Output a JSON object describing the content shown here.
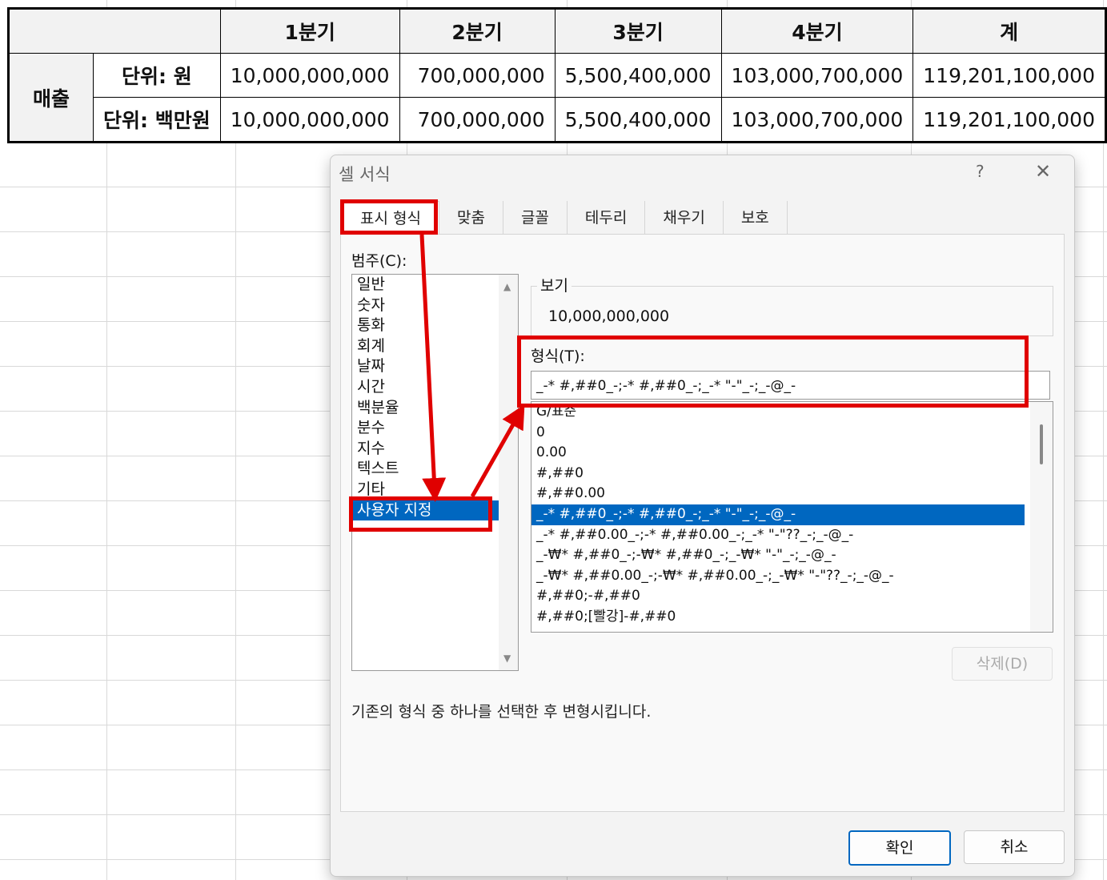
{
  "table": {
    "headers": [
      "",
      "1분기",
      "2분기",
      "3분기",
      "4분기",
      "계"
    ],
    "group_label": "매출",
    "rows": [
      {
        "unit": "단위: 원",
        "values": [
          "10,000,000,000",
          "700,000,000",
          "5,500,400,000",
          "103,000,700,000",
          "119,201,100,000"
        ]
      },
      {
        "unit": "단위: 백만원",
        "values": [
          "10,000,000,000",
          "700,000,000",
          "5,500,400,000",
          "103,000,700,000",
          "119,201,100,000"
        ]
      }
    ]
  },
  "dialog": {
    "title": "셀 서식",
    "help": "?",
    "close": "✕",
    "tabs": [
      "표시 형식",
      "맞춤",
      "글꼴",
      "테두리",
      "채우기",
      "보호"
    ],
    "category_label": "범주(C):",
    "categories": [
      "일반",
      "숫자",
      "통화",
      "회계",
      "날짜",
      "시간",
      "백분율",
      "분수",
      "지수",
      "텍스트",
      "기타",
      "사용자 지정"
    ],
    "selected_category": "사용자 지정",
    "sample_label": "보기",
    "sample_value": "10,000,000,000",
    "type_label": "형식(T):",
    "type_value": "_-* #,##0_-;-* #,##0_-;_-* \"-\"_-;_-@_-",
    "formats": [
      "G/표준",
      "0",
      "0.00",
      "#,##0",
      "#,##0.00",
      "_-* #,##0_-;-* #,##0_-;_-* \"-\"_-;_-@_-",
      "_-* #,##0.00_-;-* #,##0.00_-;_-* \"-\"??_-;_-@_-",
      "_-₩* #,##0_-;-₩* #,##0_-;_-₩* \"-\"_-;_-@_-",
      "_-₩* #,##0.00_-;-₩* #,##0.00_-;_-₩* \"-\"??_-;_-@_-",
      "#,##0;-#,##0",
      "#,##0;[빨강]-#,##0"
    ],
    "selected_format_index": 5,
    "delete_label": "삭제(D)",
    "hint": "기존의 형식 중 하나를 선택한 후 변형시킵니다.",
    "ok_label": "확인",
    "cancel_label": "취소"
  },
  "annotation_color": "#e00000",
  "selection_color": "#0067c0"
}
